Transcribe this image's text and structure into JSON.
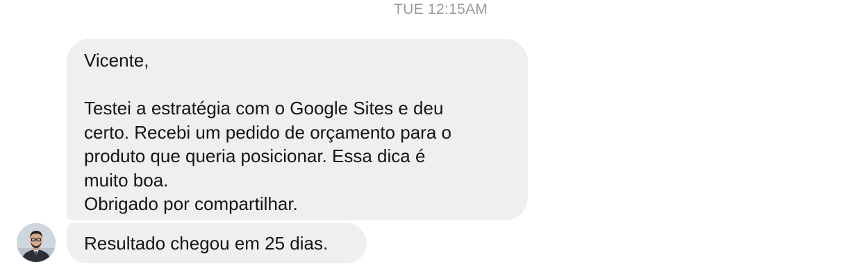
{
  "thread": {
    "timestamp": "TUE 12:15AM"
  },
  "messages": [
    {
      "lines": [
        "Vicente,",
        "",
        "Testei a estratégia com o Google Sites e deu",
        "certo. Recebi um pedido de orçamento para o",
        "produto que queria posicionar. Essa dica é",
        "muito boa.",
        "Obrigado por compartilhar."
      ]
    },
    {
      "text": "Resultado chegou em 25 dias."
    }
  ],
  "sender": {
    "avatar_icon": "person-avatar-icon"
  },
  "colors": {
    "bubble_bg": "#efefef",
    "timestamp": "#9a9a9a",
    "text": "#141414"
  }
}
